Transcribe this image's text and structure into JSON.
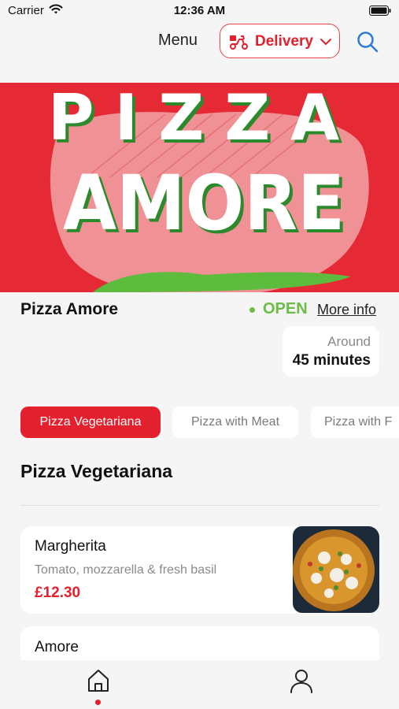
{
  "status_bar": {
    "carrier": "Carrier",
    "time": "12:36 AM"
  },
  "header": {
    "title": "Menu",
    "delivery_label": "Delivery"
  },
  "hero": {
    "line1": "PIZZA",
    "line2": "AMORE"
  },
  "restaurant": {
    "name": "Pizza Amore",
    "status": "OPEN",
    "more_info": "More info",
    "eta_label": "Around",
    "eta_value": "45 minutes"
  },
  "categories": [
    {
      "label": "Pizza Vegetariana",
      "active": true
    },
    {
      "label": "Pizza with Meat",
      "active": false
    },
    {
      "label": "Pizza with F",
      "active": false
    }
  ],
  "section": {
    "title": "Pizza Vegetariana"
  },
  "menu_items": [
    {
      "name": "Margherita",
      "description": "Tomato, mozzarella & fresh basil",
      "price": "£12.30"
    },
    {
      "name": "Amore",
      "description": "",
      "price": ""
    }
  ],
  "colors": {
    "brand_red": "#e3202d",
    "open_green": "#6cbd45",
    "background": "#f5f5f5"
  },
  "icons": [
    "wifi-icon",
    "battery-icon",
    "scooter-icon",
    "chevron-down-icon",
    "search-icon",
    "home-icon",
    "profile-icon"
  ]
}
